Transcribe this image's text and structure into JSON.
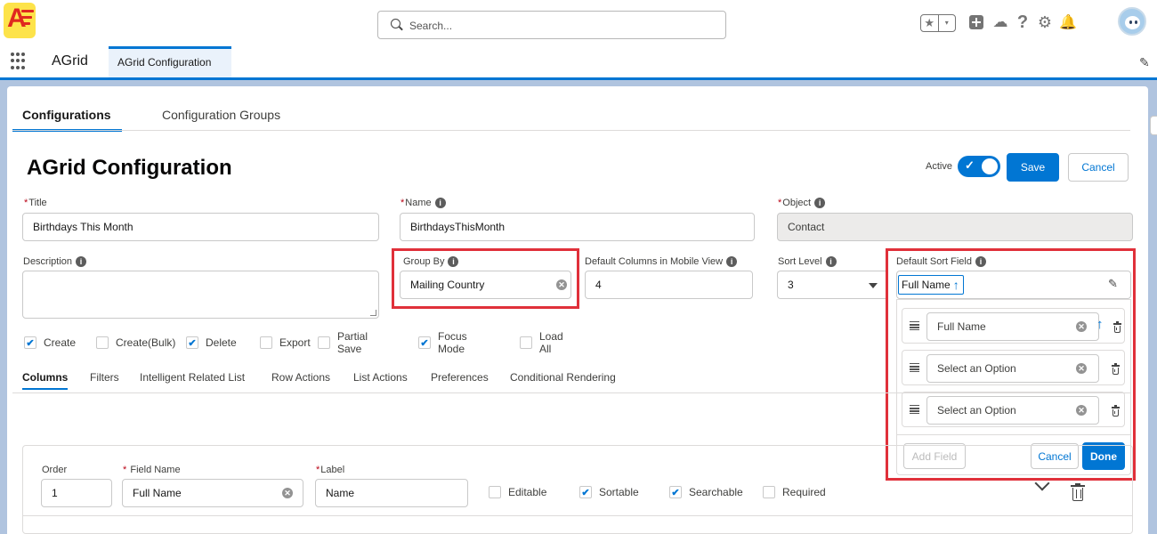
{
  "header": {
    "search_placeholder": "Search...",
    "fav_star": "★",
    "fav_dropdown": "▾",
    "trailhead_glyph": "☁",
    "help_glyph": "?",
    "setup_glyph": "⚙",
    "bell_glyph": "🔔"
  },
  "nav": {
    "app_name": "AGrid",
    "active_tab": "AGrid Configuration",
    "edit_glyph": "✎"
  },
  "tabs": {
    "configurations": "Configurations",
    "configuration_groups": "Configuration Groups"
  },
  "page": {
    "title": "AGrid Configuration",
    "active_label": "Active",
    "active": true,
    "save_label": "Save",
    "cancel_label": "Cancel"
  },
  "form": {
    "required_mark": "*",
    "info_glyph": "i",
    "clear_glyph": "✕",
    "title_label": "Title",
    "title_value": "Birthdays This Month",
    "name_label": "Name",
    "name_value": "BirthdaysThisMonth",
    "object_label": "Object",
    "object_value": "Contact",
    "description_label": "Description",
    "description_value": "",
    "group_by_label": "Group By",
    "group_by_value": "Mailing Country",
    "mobile_columns_label": "Default Columns in Mobile View",
    "mobile_columns_value": "4",
    "sort_level_label": "Sort Level",
    "sort_level_value": "3",
    "default_sort_label": "Default Sort Field"
  },
  "options": [
    {
      "label": "Create",
      "checked": true
    },
    {
      "label": "Create(Bulk)",
      "checked": false
    },
    {
      "label": "Delete",
      "checked": true
    },
    {
      "label": "Export",
      "checked": false
    },
    {
      "label": "Partial Save",
      "checked": false
    },
    {
      "label": "Focus Mode",
      "checked": true
    },
    {
      "label": "Load All",
      "checked": false
    }
  ],
  "check_glyph": "✔",
  "subtabs": [
    "Columns",
    "Filters",
    "Intelligent Related List",
    "Row Actions",
    "List Actions",
    "Preferences",
    "Conditional Rendering"
  ],
  "columns_row": {
    "order_label": "Order",
    "order_value": "1",
    "field_name_label": "Field Name",
    "field_name_value": "Full Name",
    "label_label": "Label",
    "label_value": "Name",
    "editable_label": "Editable",
    "editable": false,
    "sortable_label": "Sortable",
    "sortable": true,
    "searchable_label": "Searchable",
    "searchable": true,
    "required_label": "Required",
    "required": false
  },
  "sort_popover": {
    "pill_label": "Full Name",
    "arrow_glyph": "🡑",
    "rows": [
      {
        "value": "Full Name",
        "has_arrow": true
      },
      {
        "value": "Select an Option",
        "has_arrow": false
      },
      {
        "value": "Select an Option",
        "has_arrow": false
      }
    ],
    "add_field_label": "Add Field",
    "cancel_label": "Cancel",
    "done_label": "Done"
  }
}
